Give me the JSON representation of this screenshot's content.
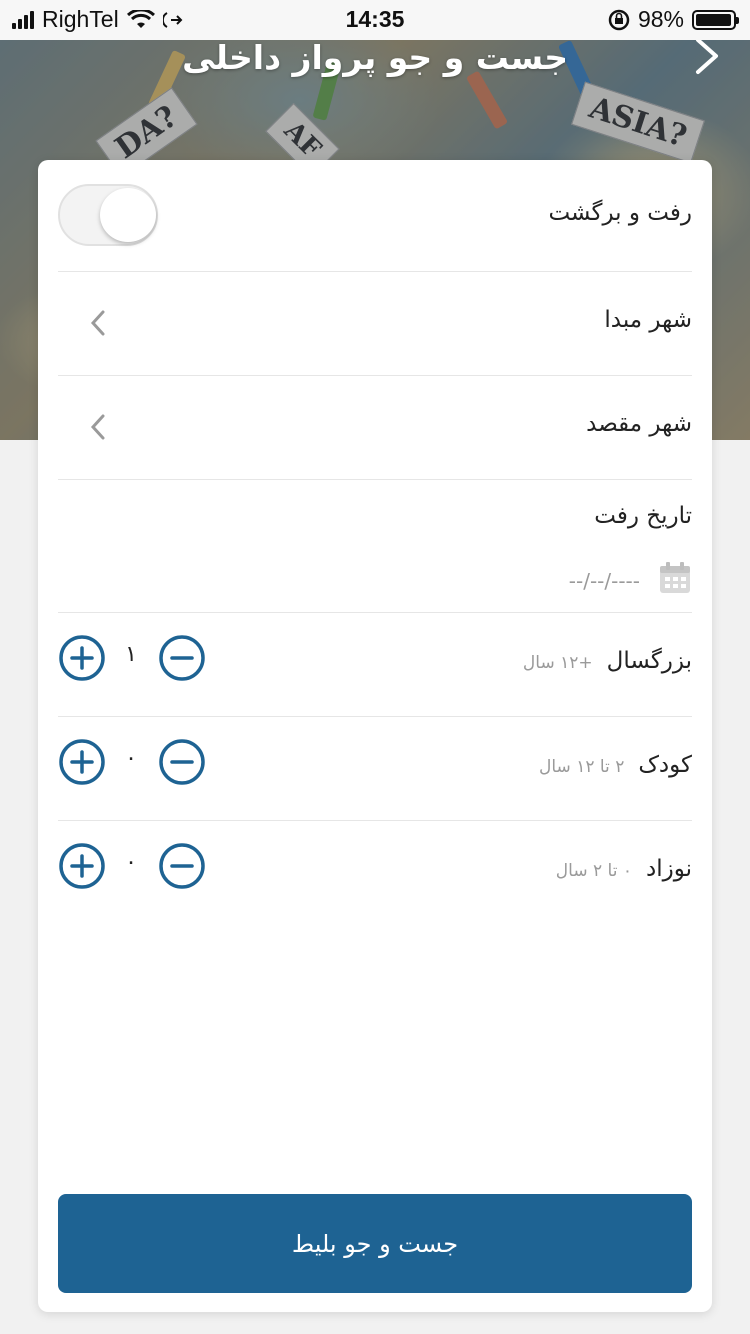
{
  "status_bar": {
    "carrier": "RighTel",
    "time": "14:35",
    "battery_percent": "98%",
    "battery_level": 0.98
  },
  "header": {
    "title": "جست و جو پرواز داخلی",
    "map_words": [
      "DA?",
      "AF",
      "ASIA?"
    ]
  },
  "form": {
    "round_trip_label": "رفت و برگشت",
    "round_trip_on": false,
    "origin_label": "شهر مبدا",
    "destination_label": "شهر مقصد",
    "departure_date_label": "تاریخ رفت",
    "departure_date_value": "--/--/----"
  },
  "passengers": [
    {
      "label": "بزرگسال",
      "sub": "+۱۲ سال",
      "count": "۱"
    },
    {
      "label": "کودک",
      "sub": "۲ تا ۱۲ سال",
      "count": "۰"
    },
    {
      "label": "نوزاد",
      "sub": "۰ تا ۲ سال",
      "count": "۰"
    }
  ],
  "search_button": {
    "label": "جست و جو بلیط"
  },
  "colors": {
    "accent": "#1e6393",
    "divider": "#e6e6e6",
    "muted": "#9a9a9a"
  },
  "icons": {
    "back": "chevron-right-icon",
    "row_arrow": "chevron-left-icon",
    "calendar": "calendar-icon",
    "plus": "plus-circle-icon",
    "minus": "minus-circle-icon"
  }
}
